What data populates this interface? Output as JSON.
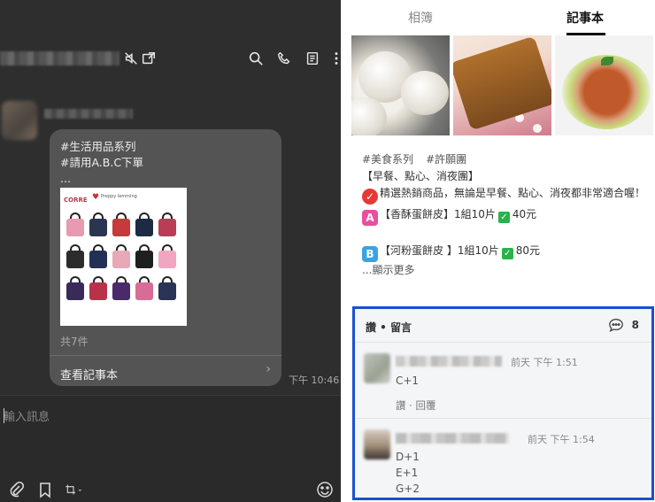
{
  "chat": {
    "header_icons": [
      "mute-icon",
      "popout-icon",
      "search-icon",
      "phone-icon",
      "note-icon",
      "more-icon"
    ],
    "message": {
      "lines": [
        "#生活用品系列",
        "#請用A.B.C下單",
        "..."
      ],
      "item_count": "共7件",
      "view_note": "查看記事本",
      "time": "下午 10:46"
    },
    "input": {
      "placeholder": "輸入訊息"
    },
    "footer_icons": [
      "attach-icon",
      "bookmark-icon",
      "crop-icon",
      "emoji-icon"
    ]
  },
  "note": {
    "tabs": [
      "相簿",
      "記事本"
    ],
    "active_tab": "記事本",
    "post": {
      "hashtags": [
        "#美食系列",
        "#許願團"
      ],
      "category": "【早餐、點心、消夜團】",
      "intro": "精選熱銷商品，無論是早餐、點心、消夜都非常適合喔！",
      "items": [
        {
          "badge": "A",
          "name": "【香酥蛋餅皮】1組10片",
          "price": "40元"
        },
        {
          "badge": "B",
          "name": "【河粉蛋餅皮 】1組10片",
          "price": "80元"
        }
      ],
      "show_more": "...顯示更多"
    },
    "comments": {
      "header": "讚 • 留言",
      "count": "8",
      "list": [
        {
          "time": "前天 下午 1:51",
          "lines": [
            "C+1"
          ],
          "actions": "讚 · 回覆"
        },
        {
          "time": "前天 下午 1:54",
          "lines": [
            "D+1",
            "E+1",
            "G+2"
          ]
        }
      ]
    }
  },
  "colors": {
    "chat_bg": "#2e2e2e",
    "bubble_bg": "#545454",
    "highlight_border": "#1a4fd1",
    "check_green": "#2bb24c"
  }
}
